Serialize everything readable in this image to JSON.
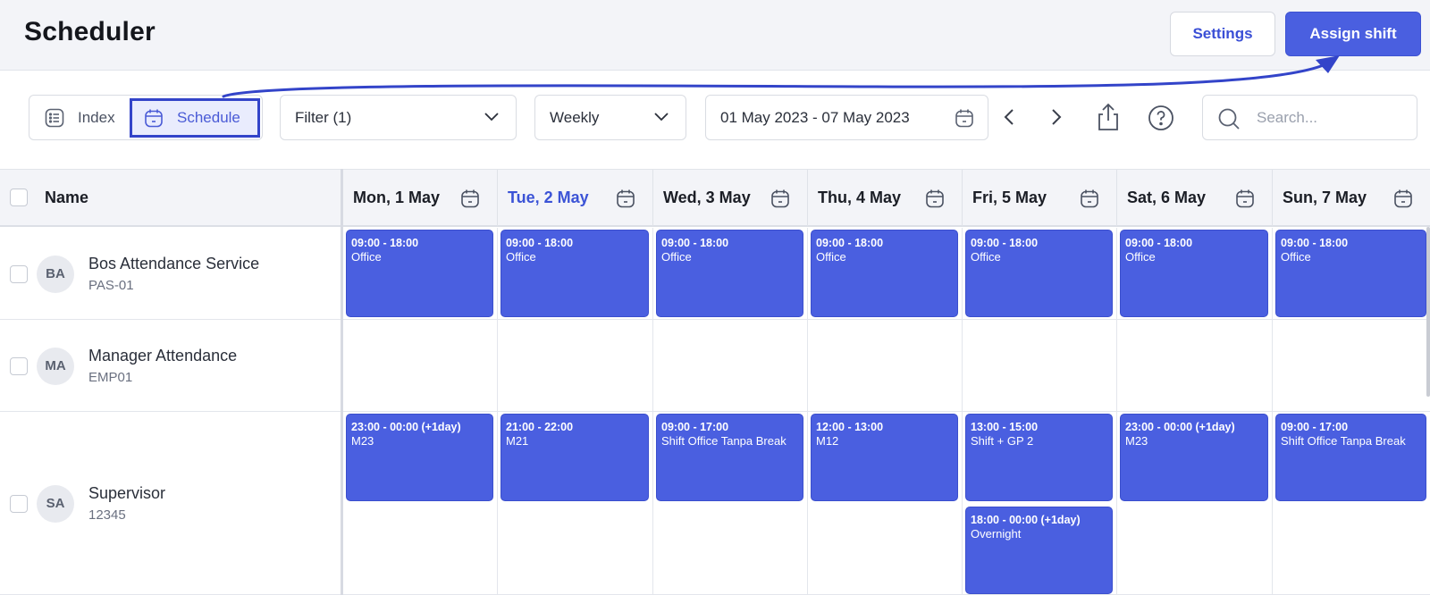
{
  "header": {
    "title": "Scheduler",
    "settings_label": "Settings",
    "assign_label": "Assign shift"
  },
  "toolbar": {
    "view_index_label": "Index",
    "view_schedule_label": "Schedule",
    "active_view": "Schedule",
    "filter_label": "Filter (1)",
    "period_label": "Weekly",
    "date_range": "01 May 2023 - 07 May 2023",
    "search_placeholder": "Search..."
  },
  "grid": {
    "name_header": "Name",
    "days": [
      {
        "label": "Mon, 1 May",
        "today": false
      },
      {
        "label": "Tue, 2 May",
        "today": true
      },
      {
        "label": "Wed, 3 May",
        "today": false
      },
      {
        "label": "Thu, 4 May",
        "today": false
      },
      {
        "label": "Fri, 5 May",
        "today": false
      },
      {
        "label": "Sat, 6 May",
        "today": false
      },
      {
        "label": "Sun, 7 May",
        "today": false
      }
    ],
    "employees": [
      {
        "initials": "BA",
        "name": "Bos Attendance Service",
        "code": "PAS-01",
        "shifts": [
          [
            {
              "time": "09:00 - 18:00",
              "place": "Office"
            }
          ],
          [
            {
              "time": "09:00 - 18:00",
              "place": "Office"
            }
          ],
          [
            {
              "time": "09:00 - 18:00",
              "place": "Office"
            }
          ],
          [
            {
              "time": "09:00 - 18:00",
              "place": "Office"
            }
          ],
          [
            {
              "time": "09:00 - 18:00",
              "place": "Office"
            }
          ],
          [
            {
              "time": "09:00 - 18:00",
              "place": "Office"
            }
          ],
          [
            {
              "time": "09:00 - 18:00",
              "place": "Office"
            }
          ]
        ]
      },
      {
        "initials": "MA",
        "name": "Manager Attendance",
        "code": "EMP01",
        "shifts": [
          [],
          [],
          [],
          [],
          [],
          [],
          []
        ]
      },
      {
        "initials": "SA",
        "name": "Supervisor",
        "code": "12345",
        "shifts": [
          [
            {
              "time": "23:00 - 00:00 (+1day)",
              "place": "M23"
            }
          ],
          [
            {
              "time": "21:00 - 22:00",
              "place": "M21"
            }
          ],
          [
            {
              "time": "09:00 - 17:00",
              "place": "Shift Office Tanpa Break"
            }
          ],
          [
            {
              "time": "12:00 - 13:00",
              "place": "M12"
            }
          ],
          [
            {
              "time": "13:00 - 15:00",
              "place": "Shift + GP 2"
            },
            {
              "time": "18:00 - 00:00 (+1day)",
              "place": "Overnight"
            }
          ],
          [
            {
              "time": "23:00 - 00:00 (+1day)",
              "place": "M23"
            }
          ],
          [
            {
              "time": "09:00 - 17:00",
              "place": "Shift Office Tanpa Break"
            }
          ]
        ]
      }
    ]
  },
  "colors": {
    "accent": "#4a5fe0",
    "today": "#3b53d6",
    "annotation": "#3344c9"
  }
}
